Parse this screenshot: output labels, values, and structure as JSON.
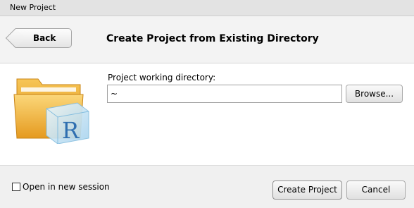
{
  "window": {
    "title": "New Project"
  },
  "header": {
    "back_label": "Back",
    "title": "Create Project from Existing Directory"
  },
  "main": {
    "icon": "r-project-folder-icon",
    "directory_label": "Project working directory:",
    "directory_value": "~",
    "browse_label": "Browse..."
  },
  "footer": {
    "open_new_session_label": "Open in new session",
    "open_new_session_checked": false,
    "create_label": "Create Project",
    "cancel_label": "Cancel"
  },
  "colors": {
    "folder": "#f2b23a",
    "cube": "#bfe0f2",
    "r_letter": "#2f6fb0"
  }
}
